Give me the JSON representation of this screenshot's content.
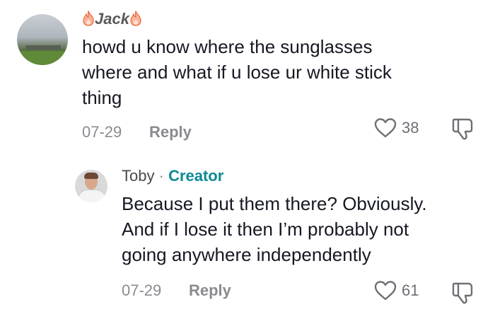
{
  "comments": [
    {
      "username": "Jack",
      "text_lines": [
        "howd u know where the sunglasses",
        "where and what if u lose ur white stick",
        "thing"
      ],
      "date": "07-29",
      "reply_label": "Reply",
      "likes": "38",
      "icons": {
        "username_decor": "fire-icon",
        "like": "heart-outline-icon",
        "dislike": "thumbs-down-outline-icon"
      }
    },
    {
      "username": "Toby",
      "separator": "·",
      "badge": "Creator",
      "text_lines": [
        "Because I put them there? Obviously.",
        "And if I lose it then I’m probably not",
        "going anywhere independently"
      ],
      "date": "07-29",
      "reply_label": "Reply",
      "likes": "61",
      "icons": {
        "like": "heart-outline-icon",
        "dislike": "thumbs-down-outline-icon"
      }
    }
  ],
  "colors": {
    "creator_badge": "#0e8a95",
    "meta_text": "#8a8b91",
    "body_text": "#161823",
    "fire": "#f2784b"
  }
}
